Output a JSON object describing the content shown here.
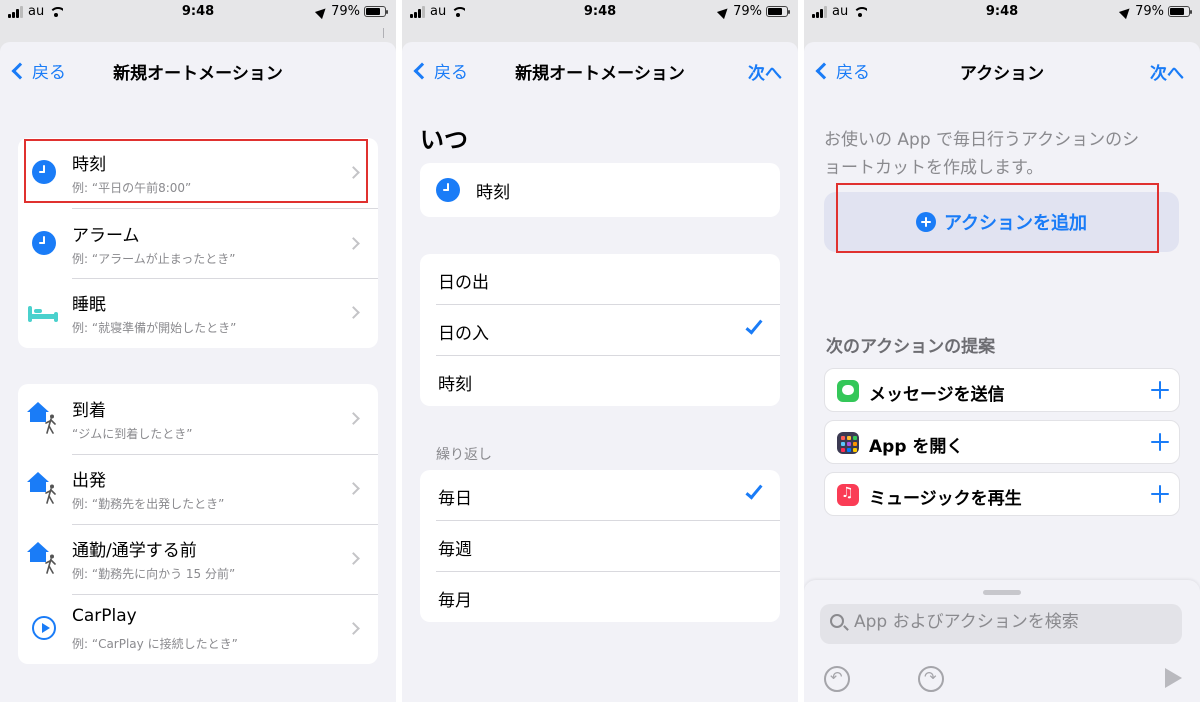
{
  "status_bar": {
    "carrier": "au",
    "time": "9:48",
    "battery": "79%",
    "battery_level": 0.79
  },
  "screen1": {
    "nav": {
      "back_label": "戻る",
      "title": "新規オートメーション"
    },
    "time_group": [
      {
        "icon": "clock-icon",
        "title": "時刻",
        "subtitle": "例: “平日の午前8:00”"
      },
      {
        "icon": "clock-icon",
        "title": "アラーム",
        "subtitle": "例: “アラームが止まったとき”"
      },
      {
        "icon": "bed-icon",
        "title": "睡眠",
        "subtitle": "例: “就寝準備が開始したとき”"
      }
    ],
    "location_group": [
      {
        "icon": "home-person-icon",
        "title": "到着",
        "subtitle": "“ジムに到着したとき”"
      },
      {
        "icon": "home-person-icon",
        "title": "出発",
        "subtitle": "例: “勤務先を出発したとき”"
      },
      {
        "icon": "home-person-icon",
        "title": "通勤/通学する前",
        "subtitle": "例: “勤務先に向かう 15 分前”"
      },
      {
        "icon": "carplay-icon",
        "title": "CarPlay",
        "subtitle": "例: “CarPlay に接続したとき”"
      }
    ]
  },
  "screen2": {
    "nav": {
      "back_label": "戻る",
      "title": "新規オートメーション",
      "next_label": "次へ"
    },
    "heading": "いつ",
    "selected_trigger": "時刻",
    "when_options": [
      {
        "label": "日の出",
        "checked": false
      },
      {
        "label": "日の入",
        "checked": true
      },
      {
        "label": "時刻",
        "checked": false
      }
    ],
    "repeat_label": "繰り返し",
    "repeat_options": [
      {
        "label": "毎日",
        "checked": true
      },
      {
        "label": "毎週",
        "checked": false
      },
      {
        "label": "毎月",
        "checked": false
      }
    ]
  },
  "screen3": {
    "nav": {
      "back_label": "戻る",
      "title": "アクション",
      "next_label": "次へ"
    },
    "intro_line1": "お使いの App で毎日行うアクションのシ",
    "intro_line2": "ョートカットを作成します。",
    "add_action_label": "アクションを追加",
    "suggestions_label": "次のアクションの提案",
    "suggestions": [
      {
        "icon": "messages-icon",
        "label": "メッセージを送信"
      },
      {
        "icon": "apps-icon",
        "label": "App を開く"
      },
      {
        "icon": "music-icon",
        "label": "ミュージックを再生"
      }
    ],
    "search_placeholder": "App およびアクションを検索"
  },
  "colors": {
    "accent": "#1a7cf7",
    "highlight_box": "#e0312f",
    "background": "#f2f2f7",
    "add_button_bg": "#e1e3f1"
  }
}
